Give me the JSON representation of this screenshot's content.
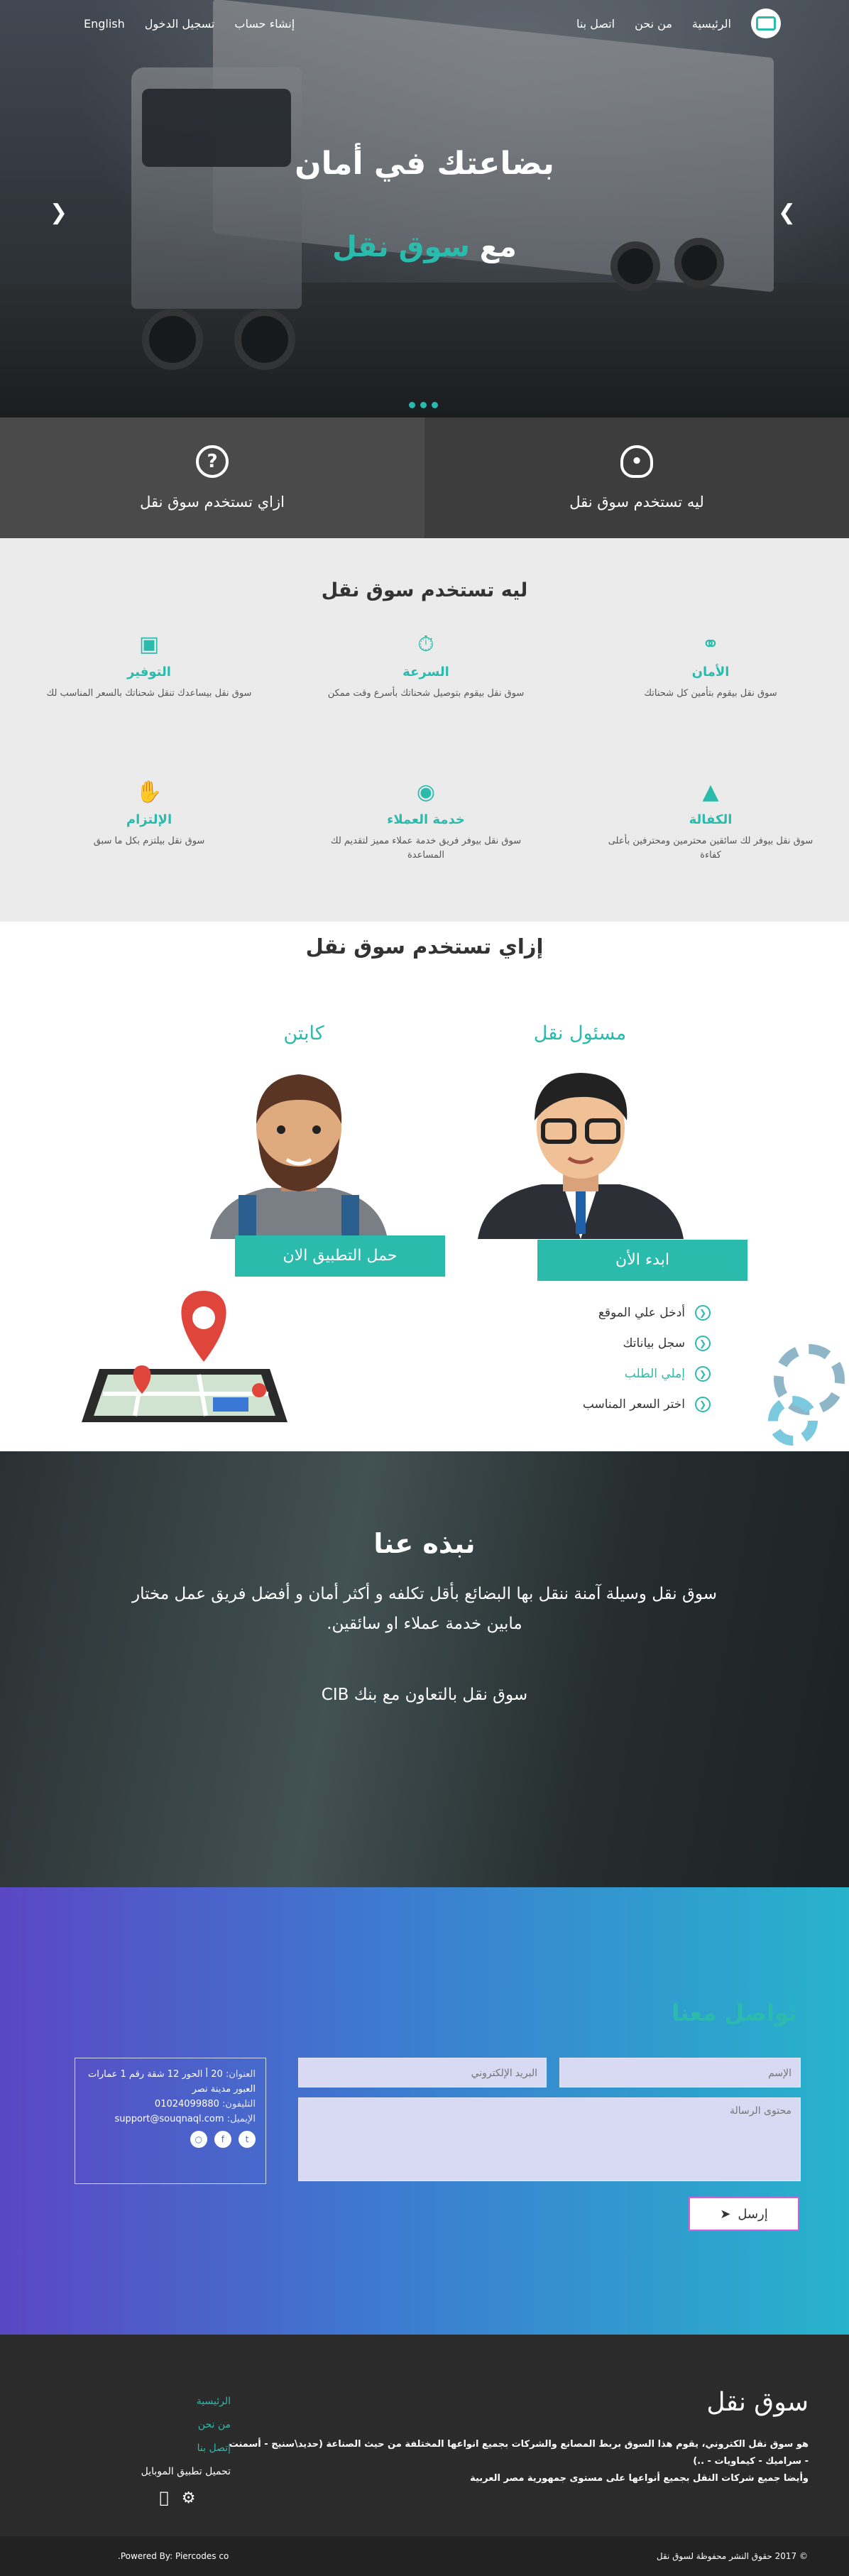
{
  "nav": {
    "home": "الرئيسية",
    "about": "من نحن",
    "contact": "اتصل بنا",
    "signup": "إنشاء حساب",
    "login": "تسجيل الدخول",
    "lang": "English"
  },
  "hero": {
    "title": "بضاعتك في أمان",
    "subtitle_prefix": "مع",
    "subtitle_brand": "سوق نقل",
    "prev_icon": "chevron-left",
    "next_icon": "chevron-right"
  },
  "panels": {
    "why_label": "ليه تستخدم سوق نقل",
    "how_label": "ازاي تستخدم سوق نقل",
    "why_icon": "lightbulb-icon",
    "how_icon": "question-icon"
  },
  "why": {
    "title": "ليه تستخدم سوق نقل",
    "features": [
      {
        "icon": "link-icon",
        "title": "الأمان",
        "desc": "سوق نقل بيقوم بتأمين كل شحناتك"
      },
      {
        "icon": "speed-icon",
        "title": "السرعة",
        "desc": "سوق نقل بيقوم بتوصيل شحناتك بأسرع وقت ممكن"
      },
      {
        "icon": "money-icon",
        "title": "التوفير",
        "desc": "سوق نقل بيساعدك تنقل شحناتك بالسعر المناسب لك"
      },
      {
        "icon": "chart-icon",
        "title": "الكفالة",
        "desc": "سوق نقل بيوفر لك سائقين محترمين ومحترفين بأعلى كفاءة"
      },
      {
        "icon": "headset-icon",
        "title": "خدمة العملاء",
        "desc": "سوق نقل بيوفر فريق خدمة عملاء مميز لتقديم لك المساعدة"
      },
      {
        "icon": "handshake-icon",
        "title": "الإلتزام",
        "desc": "سوق نقل بيلتزم بكل ما سبق"
      }
    ]
  },
  "how": {
    "title": "إزاي تستخدم سوق نقل",
    "shipper_title": "مسئول نقل",
    "captain_title": "كابتن",
    "shipper_button": "ابدء الأن",
    "captain_button": "حمل التطبيق الان",
    "steps": [
      "أدخل علي الموقع",
      "سجل بياناتك",
      "إملي الطلب",
      "اختر السعر المناسب"
    ]
  },
  "about": {
    "title": "نبذه عنا",
    "text": "سوق نقل وسيلة آمنة ننقل بها البضائع بأقل تكلفه و أكثر أمان و أفضل فريق عمل مختار مابين خدمة عملاء او سائقين.",
    "partner": "سوق نقل بالتعاون مع بنك CIB"
  },
  "contact": {
    "title": "تواصل معنا",
    "name_placeholder": "الإسم",
    "email_placeholder": "البريد الإلكتروني",
    "message_placeholder": "محتوى الرسالة",
    "send_label": "إرسل",
    "address_label": "العنوان:",
    "address_value": "20 أ الحور 12 شقة رقم 1 عمارات العبور مدينة نصر",
    "phone_label": "التليفون:",
    "phone_value": "01024099880",
    "email_label": "الإيميل:",
    "email_value": "support@souqnaql.com",
    "socials": [
      "twitter-icon",
      "facebook-icon",
      "instagram-icon"
    ]
  },
  "footer": {
    "brand": "سوق نقل",
    "desc1": "هو سوق نقل الكتروني، يقوم هذا السوق بربط المصانع والشركات بجميع انواعها المختلفة من حيث الصناعة (حديد\\سنيج - أسمنت - سراميك - كيماويات - ..)",
    "desc2": "وأيضا جميع شركات النقل بجميع أنواعها على مستوى جمهورية مصر العربية",
    "links": [
      "الرئيسية",
      "من نحن",
      "إتصل بنا"
    ],
    "download": "تحميل تطبيق الموبايل",
    "copyright": "© 2017 حقوق النشر محفوظة لسوق نقل",
    "powered": "Powered By: Piercodes co."
  },
  "colors": {
    "accent": "#2bbbad",
    "dark": "#2b2b2b"
  }
}
